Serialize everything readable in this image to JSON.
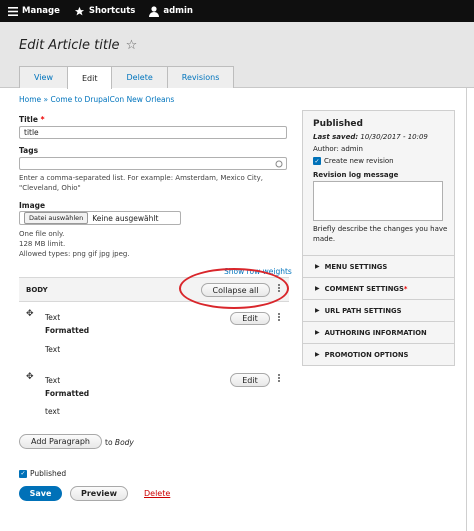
{
  "toolbar": {
    "manage_label": "Manage",
    "shortcuts_label": "Shortcuts",
    "user_label": "admin"
  },
  "header": {
    "title": "Edit Article title",
    "tabs": [
      {
        "label": "View",
        "active": false
      },
      {
        "label": "Edit",
        "active": true
      },
      {
        "label": "Delete",
        "active": false
      },
      {
        "label": "Revisions",
        "active": false
      }
    ]
  },
  "breadcrumb": "Home » Come to DrupalCon New Orleans",
  "form": {
    "title_label": "Title",
    "title_value": "title",
    "tags_label": "Tags",
    "tags_help_1": "Enter a comma-separated list. For example: Amsterdam, Mexico City,",
    "tags_help_2": "\"Cleveland, Ohio\"",
    "image_label": "Image",
    "file_button": "Datei auswählen",
    "file_status": "Keine ausgewählt",
    "image_help_1": "One file only.",
    "image_help_2": "128 MB limit.",
    "image_help_3": "Allowed types: png gif jpg jpeg.",
    "show_row_weights": "Show row weights",
    "body_label": "BODY",
    "collapse_all": "Collapse all",
    "paragraphs": [
      {
        "type": "Text",
        "format": "Formatted",
        "content": "Text",
        "button": "Edit"
      },
      {
        "type": "Text",
        "format": "Formatted",
        "content": "text",
        "button": "Edit"
      }
    ],
    "add_paragraph": "Add Paragraph",
    "add_to": "to",
    "add_target": "Body",
    "published_label": "Published",
    "save": "Save",
    "preview": "Preview",
    "delete": "Delete"
  },
  "sidebar": {
    "status": "Published",
    "last_saved_label": "Last saved:",
    "last_saved_value": "10/30/2017 - 10:09",
    "author": "Author: admin",
    "new_revision": "Create new revision",
    "revision_log_label": "Revision log message",
    "revision_help_1": "Briefly describe the changes you have",
    "revision_help_2": "made.",
    "sections": [
      {
        "label": "MENU SETTINGS",
        "required": false
      },
      {
        "label": "COMMENT SETTINGS",
        "required": true
      },
      {
        "label": "URL PATH SETTINGS",
        "required": false
      },
      {
        "label": "AUTHORING INFORMATION",
        "required": false
      },
      {
        "label": "PROMOTION OPTIONS",
        "required": false
      }
    ]
  },
  "colors": {
    "primary": "#0071b8",
    "link": "#0074bd",
    "annotation": "#d9262b",
    "danger": "#cc0000"
  }
}
